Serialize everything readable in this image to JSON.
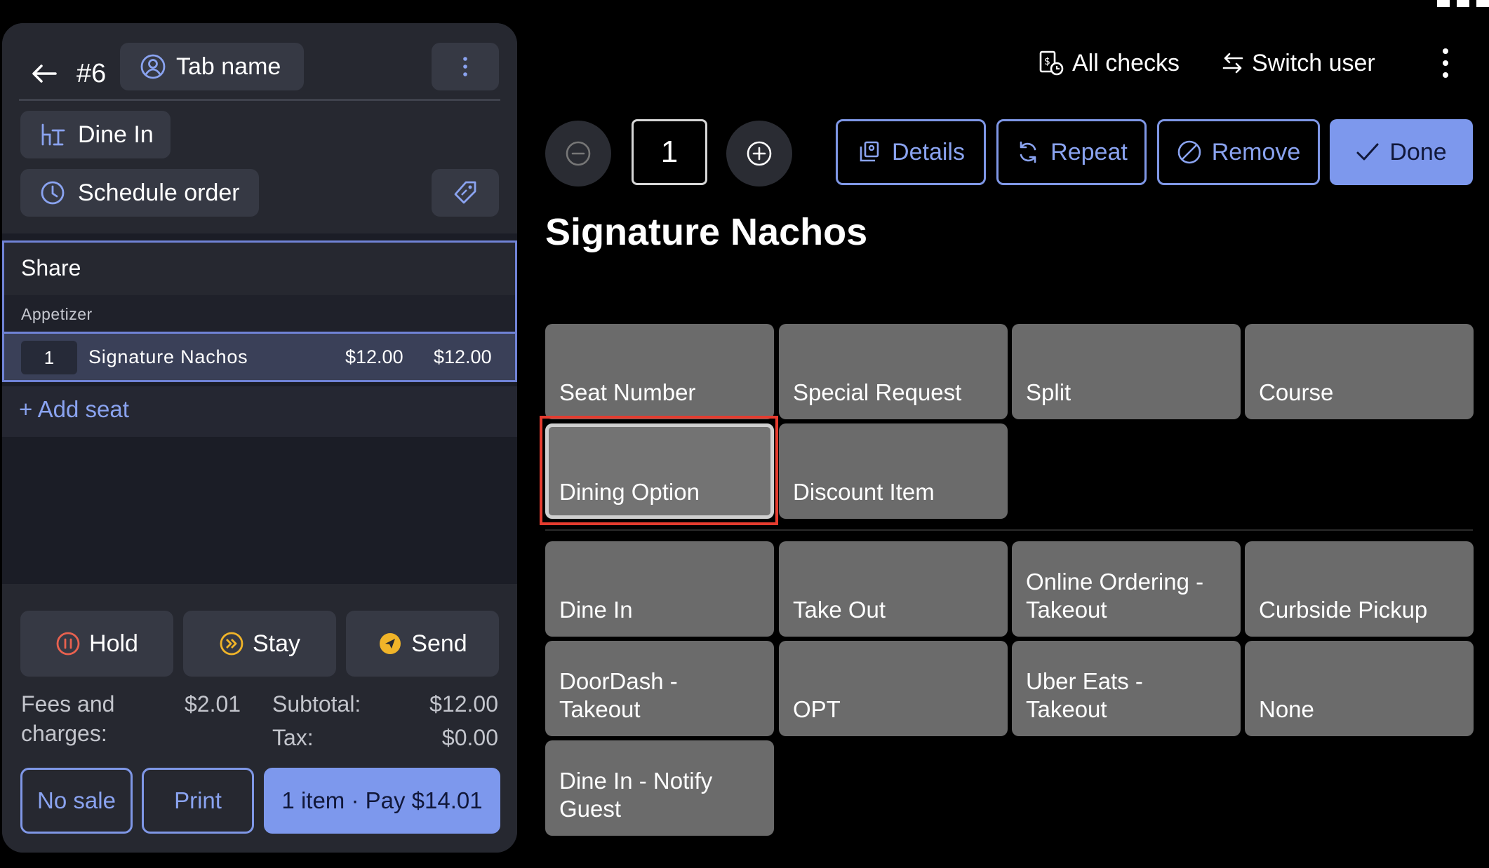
{
  "header": {
    "tab_number": "#6",
    "tab_name_label": "Tab name",
    "dining_label": "Dine In",
    "schedule_label": "Schedule order"
  },
  "order": {
    "seat_title": "Share",
    "category": "Appetizer",
    "items": [
      {
        "qty": "1",
        "name": "Signature Nachos",
        "price": "$12.00",
        "total": "$12.00"
      }
    ],
    "add_seat_label": "+ Add seat"
  },
  "footer": {
    "hold_label": "Hold",
    "stay_label": "Stay",
    "send_label": "Send",
    "fees_label_line1": "Fees and",
    "fees_label_line2": "charges:",
    "fees_value": "$2.01",
    "subtotal_label": "Subtotal:",
    "subtotal_value": "$12.00",
    "tax_label": "Tax:",
    "tax_value": "$0.00",
    "no_sale_label": "No sale",
    "print_label": "Print",
    "pay_label": "1 item · Pay $14.01"
  },
  "topbar": {
    "all_checks_label": "All checks",
    "switch_user_label": "Switch user"
  },
  "editor": {
    "quantity": "1",
    "details_label": "Details",
    "repeat_label": "Repeat",
    "remove_label": "Remove",
    "done_label": "Done",
    "item_title": "Signature Nachos"
  },
  "modifiers": {
    "seat_number": "Seat Number",
    "special_request": "Special Request",
    "split": "Split",
    "course": "Course",
    "dining_option": "Dining Option",
    "discount_item": "Discount Item"
  },
  "dining_options": {
    "dine_in": "Dine In",
    "take_out": "Take Out",
    "online_line1": "Online Ordering -",
    "online_line2": "Takeout",
    "curbside": "Curbside Pickup",
    "doordash_line1": "DoorDash -",
    "doordash_line2": "Takeout",
    "opt": "OPT",
    "ubereats_line1": "Uber Eats -",
    "ubereats_line2": "Takeout",
    "none": "None",
    "notify_line1": "Dine In - Notify",
    "notify_line2": "Guest"
  },
  "colors": {
    "accent": "#7d98ed",
    "highlight": "#e53c2f",
    "panel": "#262830",
    "tile": "#6b6b6b"
  }
}
